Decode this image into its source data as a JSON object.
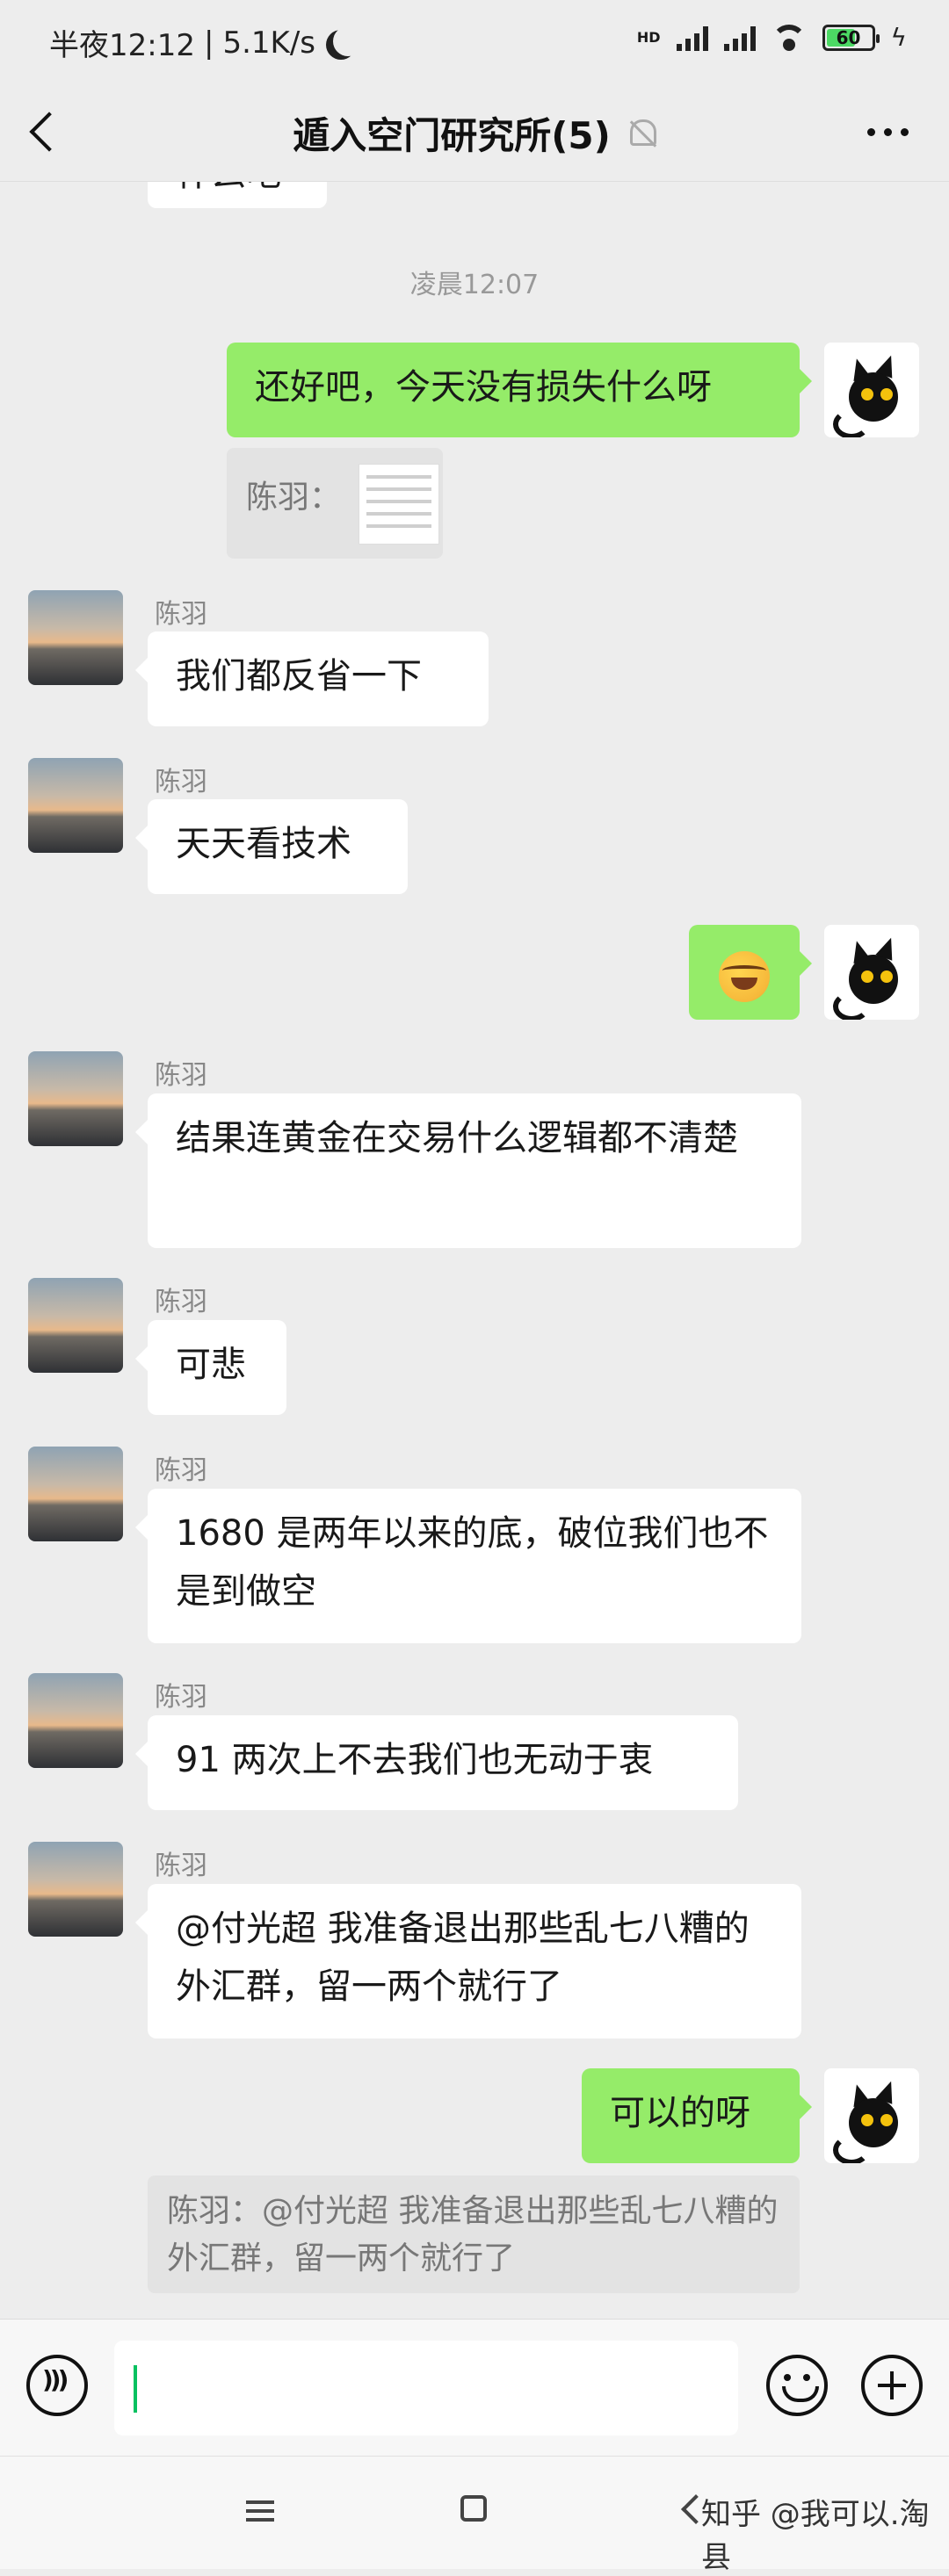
{
  "status_bar": {
    "time": "半夜12:12",
    "speed": "5.1K/s",
    "battery": "60",
    "network": "HD"
  },
  "header": {
    "title": "遁入空门研究所(5)"
  },
  "chat": {
    "partial_top_text": "什么吧",
    "timestamp": "凌晨12:07",
    "messages": [
      {
        "from": "me",
        "text": "还好吧，今天没有损失什么呀"
      },
      {
        "from": "me_quote",
        "quote_name": "陈羽："
      },
      {
        "from": "陈羽",
        "text": "我们都反省一下"
      },
      {
        "from": "陈羽",
        "text": "天天看技术"
      },
      {
        "from": "me",
        "emoji": "laughing-crying-emoji"
      },
      {
        "from": "陈羽",
        "text": "结果连黄金在交易什么逻辑都不清楚"
      },
      {
        "from": "陈羽",
        "text": "可悲"
      },
      {
        "from": "陈羽",
        "text": "1680 是两年以来的底，破位我们也不是到做空"
      },
      {
        "from": "陈羽",
        "text": "91 两次上不去我们也无动于衷"
      },
      {
        "from": "陈羽",
        "text": "@付光超  我准备退出那些乱七八糟的外汇群，留一两个就行了"
      },
      {
        "from": "me",
        "text": "可以的呀"
      },
      {
        "from": "quote",
        "text": "陈羽：@付光超 我准备退出那些乱七八糟的外汇群，留一两个就行了"
      }
    ]
  },
  "bottom": {
    "watermark": "知乎 @我可以.淘县"
  },
  "colors": {
    "background": "#ededed",
    "my_bubble": "#95ec69",
    "other_bubble": "#ffffff",
    "caret": "#07c160"
  }
}
